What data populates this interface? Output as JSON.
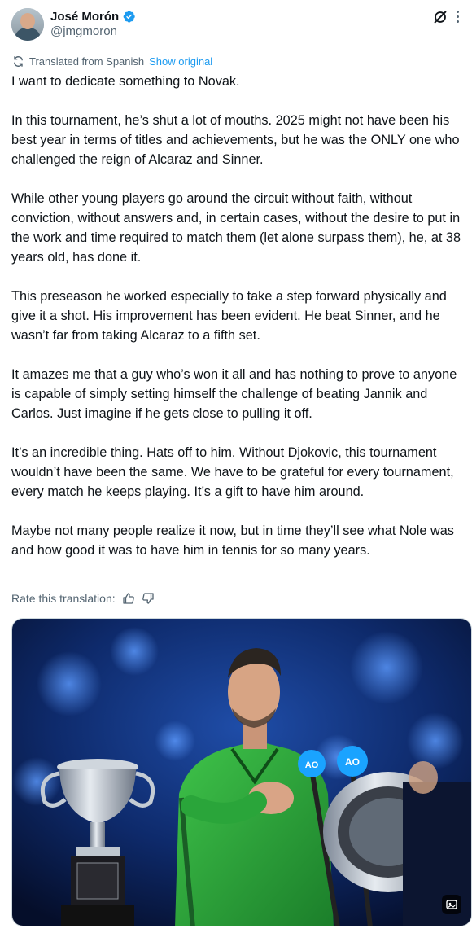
{
  "author": {
    "name": "José Morón",
    "handle": "@jmgmoron",
    "verified": true,
    "verified_color": "#1d9bf0"
  },
  "translation": {
    "note": "Translated from Spanish",
    "show_original": "Show original"
  },
  "tweet": {
    "paragraphs": [
      "I want to dedicate something to Novak.",
      "In this tournament, he’s shut a lot of mouths. 2025 might not have been his best year in terms of titles and achievements, but he was the ONLY one who challenged the reign of Alcaraz and Sinner.",
      "While other young players go around the circuit without faith, without conviction, without answers and, in certain cases, without the desire to put in the work and time required to match them (let alone surpass them), he, at 38 years old, has done it.",
      "This preseason he worked especially to take a step forward physically and give it a shot. His improvement has been evident. He beat Sinner, and he wasn’t far from taking Alcaraz to a fifth set.",
      "It amazes me that a guy who’s won it all and has nothing to prove to anyone is capable of simply setting himself the challenge of beating Jannik and Carlos. Just imagine if he gets close to pulling it off.",
      "It’s an incredible thing. Hats off to him. Without Djokovic, this tournament wouldn’t have been the same. We have to be grateful for every tournament, every match he keeps playing. It’s a gift to have him around.",
      "Maybe not many people realize it now, but in time they’ll see what Nole was and how good it was to have him in tennis for so many years."
    ]
  },
  "rate": {
    "label": "Rate this translation:"
  },
  "media": {
    "mic_logo": "AO"
  },
  "icons": {
    "verified": "verified-badge-icon",
    "grok": "grok-icon",
    "more": "more-options-icon",
    "translate": "translate-icon",
    "thumbs_up": "thumbs-up-icon",
    "thumbs_down": "thumbs-down-icon",
    "media_badge": "image-options-icon"
  }
}
